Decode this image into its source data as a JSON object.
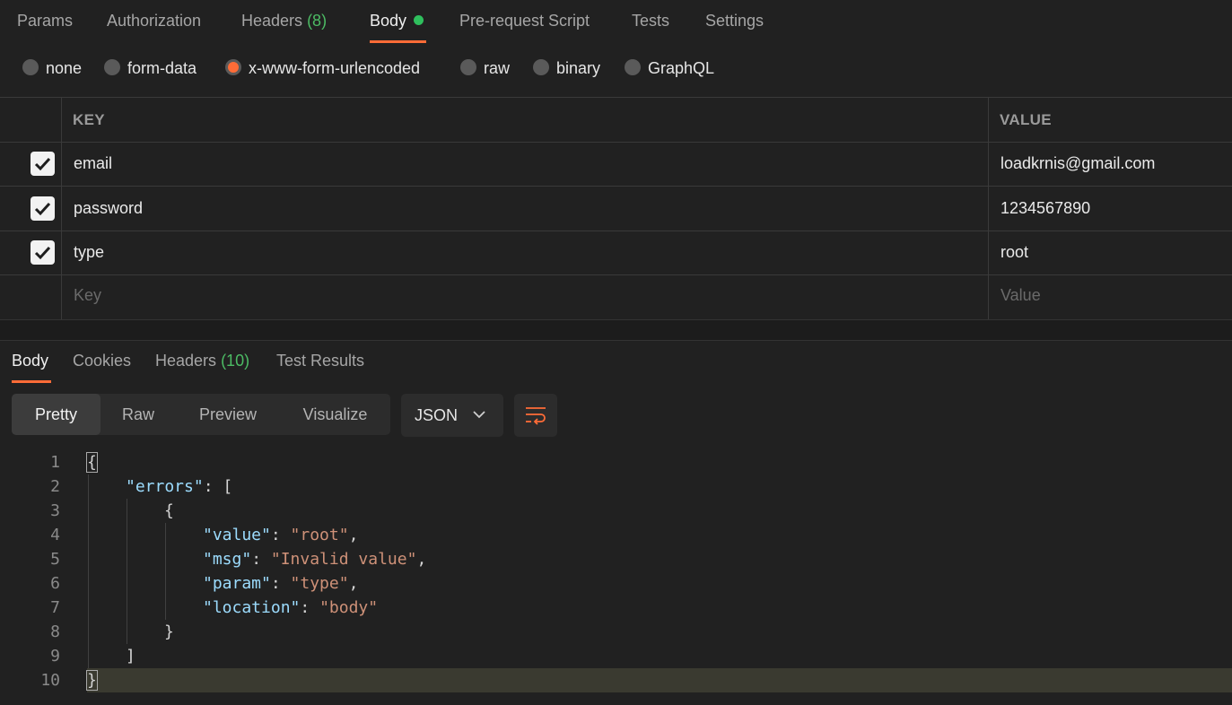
{
  "request_tabs": [
    {
      "label": "Params"
    },
    {
      "label": "Authorization"
    },
    {
      "label": "Headers",
      "count": "(8)"
    },
    {
      "label": "Body"
    },
    {
      "label": "Pre-request Script"
    },
    {
      "label": "Tests"
    },
    {
      "label": "Settings"
    }
  ],
  "body_types": [
    "none",
    "form-data",
    "x-www-form-urlencoded",
    "raw",
    "binary",
    "GraphQL"
  ],
  "selected_body_type": "x-www-form-urlencoded",
  "table": {
    "key_header": "KEY",
    "value_header": "VALUE",
    "rows": [
      {
        "checked": true,
        "key": "email",
        "value": "loadkrnis@gmail.com"
      },
      {
        "checked": true,
        "key": "password",
        "value": "1234567890"
      },
      {
        "checked": true,
        "key": "type",
        "value": "root"
      }
    ],
    "key_placeholder": "Key",
    "value_placeholder": "Value"
  },
  "response_tabs": [
    {
      "label": "Body"
    },
    {
      "label": "Cookies"
    },
    {
      "label": "Headers",
      "count": "(10)"
    },
    {
      "label": "Test Results"
    }
  ],
  "view_modes": [
    "Pretty",
    "Raw",
    "Preview",
    "Visualize"
  ],
  "format": "JSON",
  "code": {
    "line_numbers": [
      "1",
      "2",
      "3",
      "4",
      "5",
      "6",
      "7",
      "8",
      "9",
      "10"
    ],
    "open_brace": "{",
    "errors_key": "\"errors\"",
    "open_bracket": "[",
    "inner_open": "{",
    "pairs": [
      {
        "key": "\"value\"",
        "value": "\"root\"",
        "comma": ","
      },
      {
        "key": "\"msg\"",
        "value": "\"Invalid value\"",
        "comma": ","
      },
      {
        "key": "\"param\"",
        "value": "\"type\"",
        "comma": ","
      },
      {
        "key": "\"location\"",
        "value": "\"body\"",
        "comma": ""
      }
    ],
    "inner_close": "}",
    "close_bracket": "]",
    "close_brace": "}"
  },
  "colors": {
    "accent": "#ff6c37",
    "success": "#2fbf5d",
    "key": "#9cdcfe",
    "string": "#ce9178"
  }
}
